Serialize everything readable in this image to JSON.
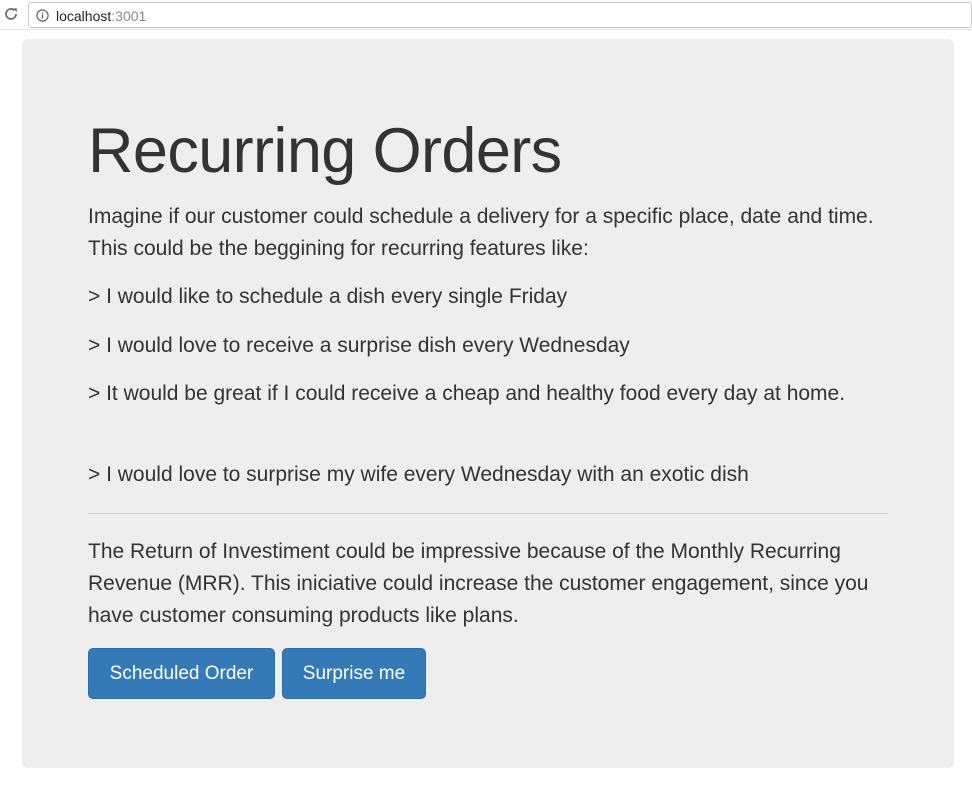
{
  "browser": {
    "url_host": "localhost",
    "url_port": ":3001"
  },
  "jumbotron": {
    "title": "Recurring Orders",
    "intro": "Imagine if our customer could schedule a delivery for a specific place, date and time. This could be the beggining for recurring features like:",
    "quotes": [
      "> I would like to schedule a dish every single Friday",
      "> I would love to receive a surprise dish every Wednesday",
      "> It would be great if I could receive a cheap and healthy food every day at home.",
      "> I would love to surprise my wife every Wednesday with an exotic dish"
    ],
    "roi": "The Return of Investiment could be impressive because of the Monthly Recurring Revenue (MRR). This iniciative could increase the customer engagement, since you have customer consuming products like plans.",
    "buttons": {
      "scheduled_label": "Scheduled Order",
      "surprise_label": "Surprise me"
    }
  },
  "colors": {
    "jumbotron_bg": "#eeeeee",
    "primary_button": "#337ab7",
    "text": "#333333"
  },
  "icons": [
    "reload-icon",
    "info-icon"
  ]
}
